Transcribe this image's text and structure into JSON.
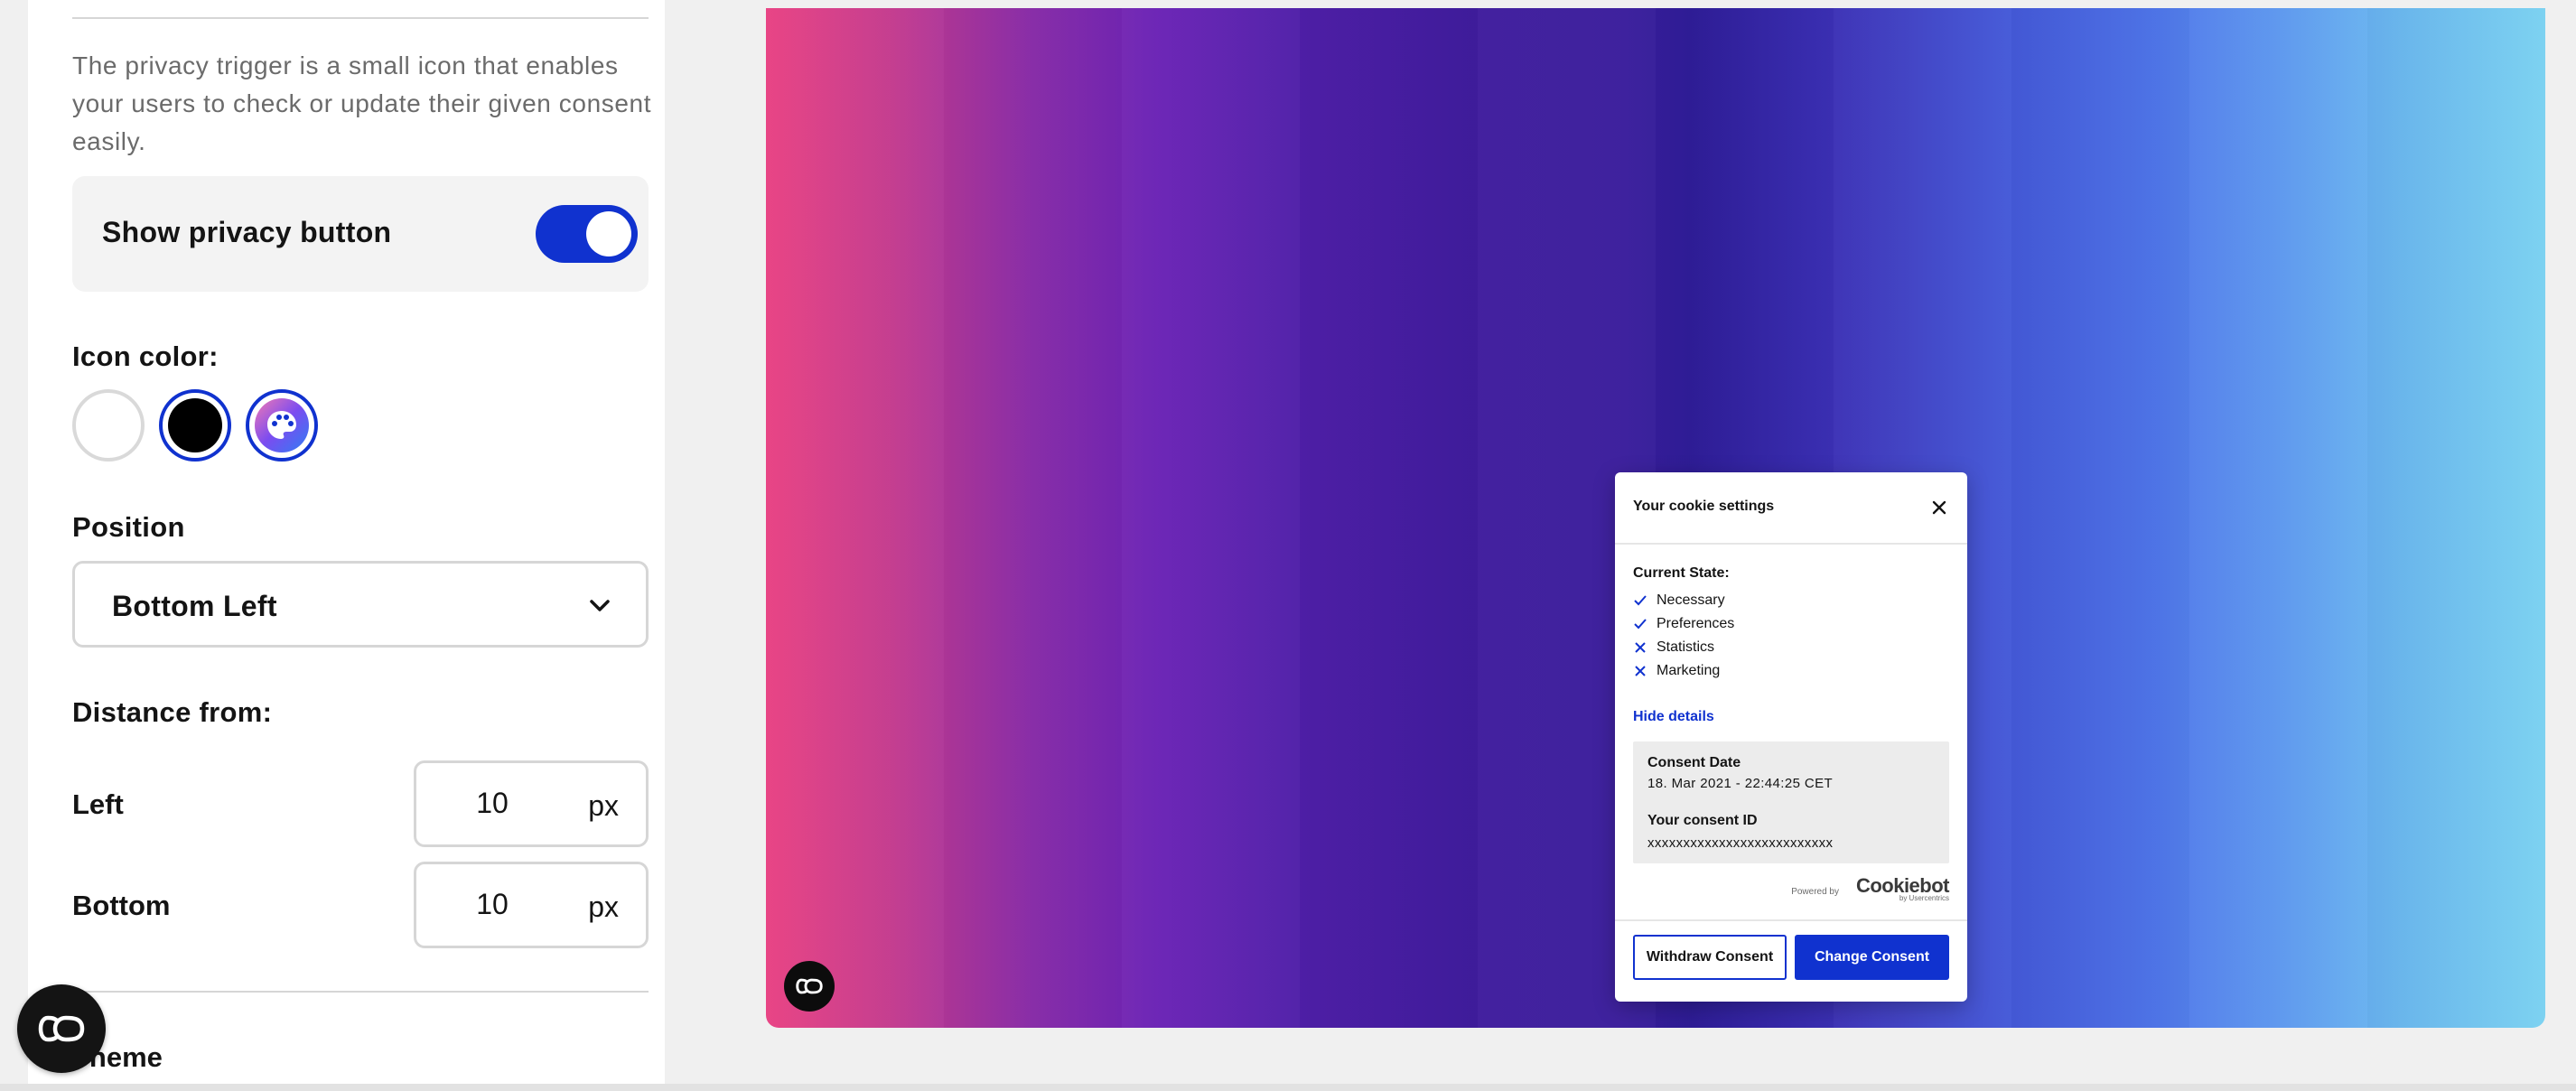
{
  "settings": {
    "description": "The privacy trigger is a small icon that enables your users to check or update their given consent easily.",
    "show_privacy_button": {
      "label": "Show privacy button",
      "enabled": true
    },
    "icon_color": {
      "title": "Icon color:",
      "options": [
        "white",
        "black",
        "custom"
      ],
      "selected": "black"
    },
    "position": {
      "title": "Position",
      "value": "Bottom Left"
    },
    "distance": {
      "title": "Distance from:",
      "left": {
        "label": "Left",
        "value": "10",
        "unit": "px"
      },
      "bottom": {
        "label": "Bottom",
        "value": "10",
        "unit": "px"
      }
    },
    "theme": {
      "title": "Theme"
    }
  },
  "popup": {
    "title": "Your cookie settings",
    "current_state_title": "Current State:",
    "states": [
      {
        "label": "Necessary",
        "consented": true
      },
      {
        "label": "Preferences",
        "consented": true
      },
      {
        "label": "Statistics",
        "consented": false
      },
      {
        "label": "Marketing",
        "consented": false
      }
    ],
    "hide_details": "Hide details",
    "consent_date_label": "Consent Date",
    "consent_date_value": "18. Mar 2021 - 22:44:25 CET",
    "consent_id_label": "Your consent ID",
    "consent_id_value": "xxxxxxxxxxxxxxxxxxxxxxxxxx",
    "powered_by": "Powered by",
    "brand": "Cookiebot",
    "brand_sub": "by Usercentrics",
    "withdraw_label": "Withdraw Consent",
    "change_label": "Change Consent"
  },
  "colors": {
    "accent": "#1032cf",
    "text": "#141414",
    "muted": "#6b6b6b"
  },
  "icons": {
    "trigger": "cookiebot-trigger-icon",
    "close": "close-icon",
    "check": "check-icon",
    "cross": "cross-icon",
    "chevron": "chevron-down-icon",
    "palette": "palette-icon"
  }
}
